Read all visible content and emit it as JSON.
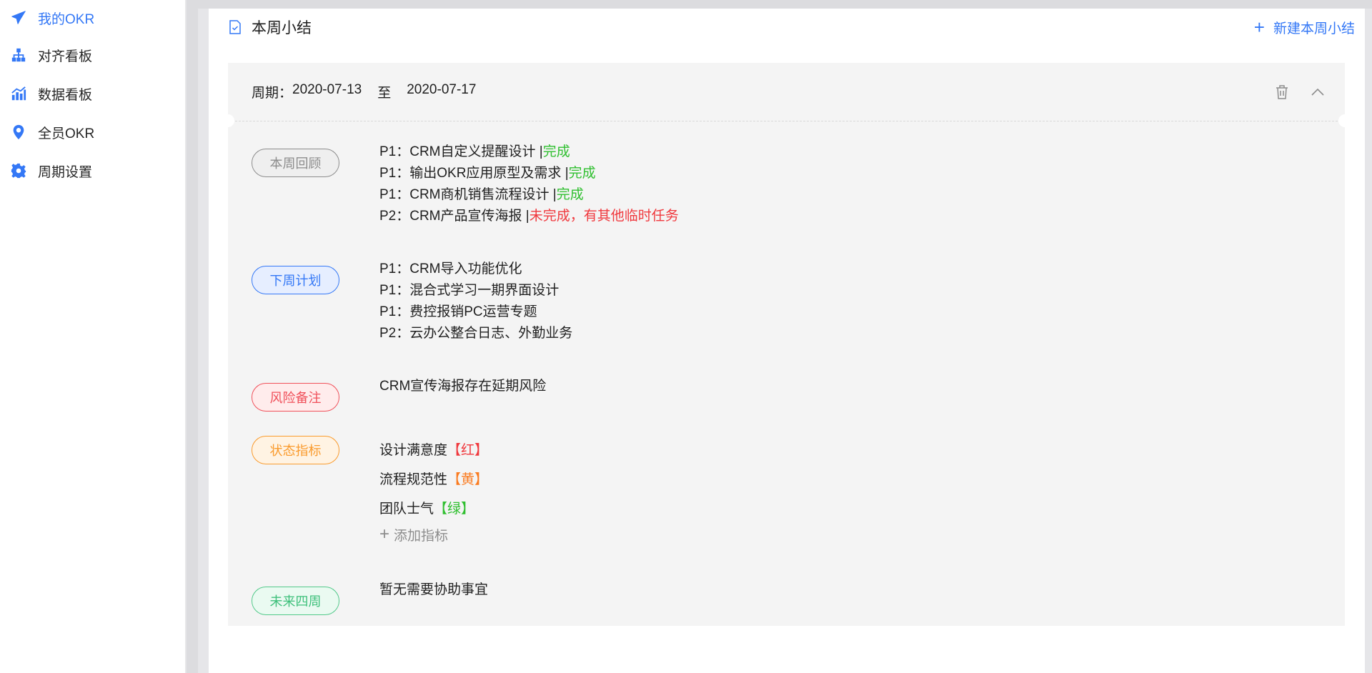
{
  "sidebar": {
    "items": [
      {
        "label": "我的OKR",
        "icon": "paper-plane-icon",
        "active": true
      },
      {
        "label": "对齐看板",
        "icon": "org-tree-icon",
        "active": false
      },
      {
        "label": "数据看板",
        "icon": "bar-chart-icon",
        "active": false
      },
      {
        "label": "全员OKR",
        "icon": "location-pin-icon",
        "active": false
      },
      {
        "label": "周期设置",
        "icon": "gear-icon",
        "active": false
      }
    ]
  },
  "panel": {
    "title": "本周小结",
    "new_button": "新建本周小结"
  },
  "summary": {
    "period_label": "周期：",
    "start_date": "2020-07-13",
    "period_sep": "至",
    "end_date": "2020-07-17",
    "review": {
      "tag": "本周回顾",
      "items": [
        {
          "text": "P1：CRM自定义提醒设计",
          "pipe": "|",
          "status": "完成",
          "status_kind": "done"
        },
        {
          "text": "P1：输出OKR应用原型及需求",
          "pipe": "|",
          "status": "完成",
          "status_kind": "done"
        },
        {
          "text": "P1：CRM商机销售流程设计",
          "pipe": "|",
          "status": "完成",
          "status_kind": "done"
        },
        {
          "text": "P2：CRM产品宣传海报",
          "pipe": "|",
          "status": "未完成，有其他临时任务",
          "status_kind": "undone"
        }
      ]
    },
    "plan": {
      "tag": "下周计划",
      "items": [
        "P1：CRM导入功能优化",
        "P1：混合式学习一期界面设计",
        "P1：费控报销PC运营专题",
        "P2：云办公整合日志、外勤业务"
      ]
    },
    "risk": {
      "tag": "风险备注",
      "text": "CRM宣传海报存在延期风险"
    },
    "indicators": {
      "tag": "状态指标",
      "items": [
        {
          "name": "设计满意度",
          "level": "【红】",
          "color": "#f0383d"
        },
        {
          "name": "流程规范性",
          "level": "【黄】",
          "color": "#fa7a1e"
        },
        {
          "name": "团队士气",
          "level": "【绿】",
          "color": "#2fbf2f"
        }
      ],
      "add_label": "添加指标"
    },
    "future": {
      "tag": "未来四周",
      "text": "暂无需要协助事宜"
    }
  },
  "colors": {
    "accent": "#3478f6",
    "done": "#2fbf2f",
    "undone": "#f0383d"
  }
}
